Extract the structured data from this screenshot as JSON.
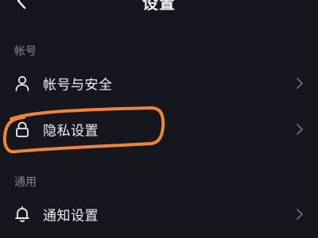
{
  "header": {
    "title": "设置",
    "back_icon": "chevron-left-icon"
  },
  "sections": [
    {
      "label": "帐号",
      "items": [
        {
          "label": "帐号与安全",
          "icon": "person-icon"
        },
        {
          "label": "隐私设置",
          "icon": "lock-icon",
          "highlighted": true
        }
      ]
    },
    {
      "label": "通用",
      "items": [
        {
          "label": "通知设置",
          "icon": "bell-icon"
        }
      ]
    }
  ],
  "colors": {
    "background": "#16161e",
    "text": "#f0f0f3",
    "section_label": "#86878f",
    "chevron": "#6c6d75",
    "highlight": "#f0843a"
  }
}
